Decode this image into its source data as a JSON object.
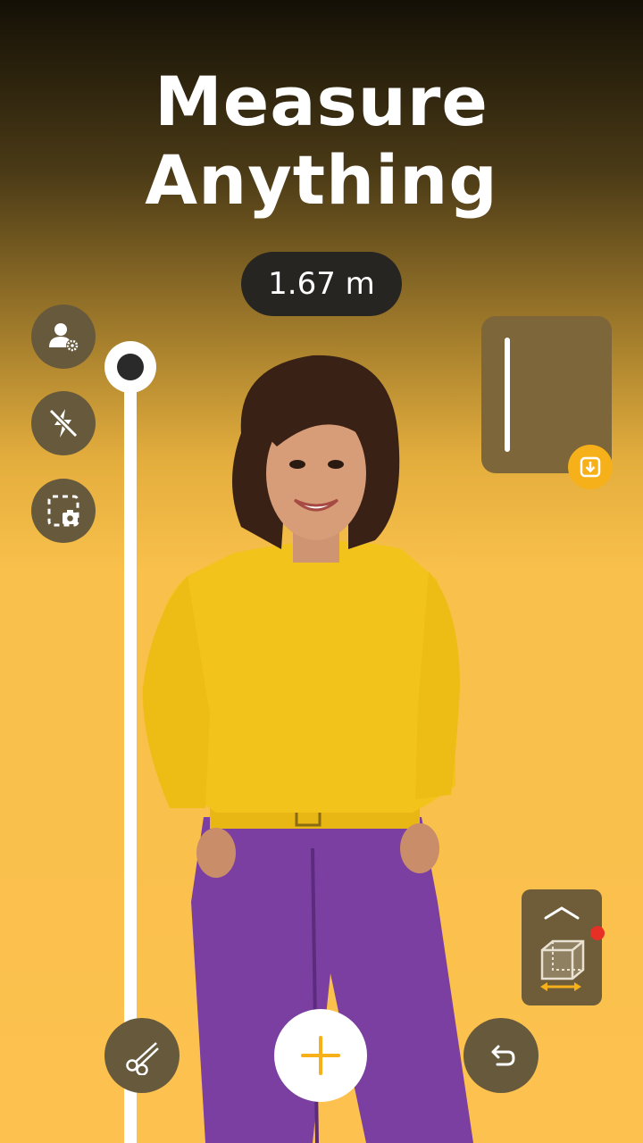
{
  "title": {
    "line1": "Measure",
    "line2": "Anything"
  },
  "measurement": {
    "value": "1.67 m"
  },
  "left_toolbar": {
    "items": [
      {
        "name": "person-settings",
        "icon": "person-gear-icon"
      },
      {
        "name": "flash-off",
        "icon": "flash-off-icon"
      },
      {
        "name": "screenshot",
        "icon": "screenshot-icon"
      }
    ]
  },
  "ruler": {
    "handle_icon": "ruler-handle"
  },
  "preview": {
    "download_icon": "download-icon"
  },
  "mode_panel": {
    "chevron_icon": "chevron-up-icon",
    "cube_icon": "cube-measure-icon",
    "notification_color": "#e63026"
  },
  "bottom_bar": {
    "left_icon": "scissors-icon",
    "center_icon": "plus-icon",
    "right_icon": "undo-icon"
  },
  "colors": {
    "accent": "#f6b019",
    "background": "#fcc14e",
    "button_bg": "#675a3c",
    "pill_bg": "#272522"
  }
}
